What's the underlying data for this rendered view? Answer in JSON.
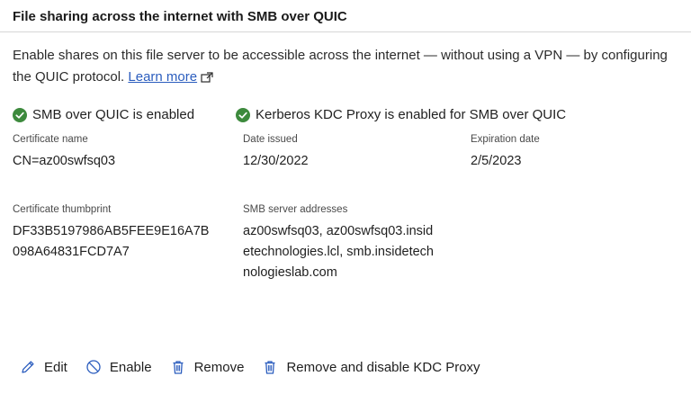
{
  "section": {
    "title": "File sharing across the internet with SMB over QUIC",
    "description": "Enable shares on this file server to be accessible across the internet — without using a VPN — by configuring the QUIC protocol.",
    "learn_more": "Learn more"
  },
  "status": {
    "smb_quic": "SMB over QUIC is enabled",
    "kdc_proxy": "Kerberos KDC Proxy is enabled for SMB over QUIC",
    "ok_color": "#3d8a3d"
  },
  "fields": {
    "cert_name_label": "Certificate name",
    "cert_name_value": "CN=az00swfsq03",
    "date_issued_label": "Date issued",
    "date_issued_value": "12/30/2022",
    "expiration_label": "Expiration date",
    "expiration_value": "2/5/2023",
    "thumbprint_label": "Certificate thumbprint",
    "thumbprint_value": "DF33B5197986AB5FEE9E16A7B098A64831FCD7A7",
    "addresses_label": "SMB server addresses",
    "addresses_value": "az00swfsq03, az00swfsq03.insidetechnologies.lcl, smb.insidetechnologieslab.com"
  },
  "actions": {
    "edit": "Edit",
    "enable": "Enable",
    "remove": "Remove",
    "remove_disable": "Remove and disable KDC Proxy",
    "icon_color": "#2b5dbe"
  }
}
